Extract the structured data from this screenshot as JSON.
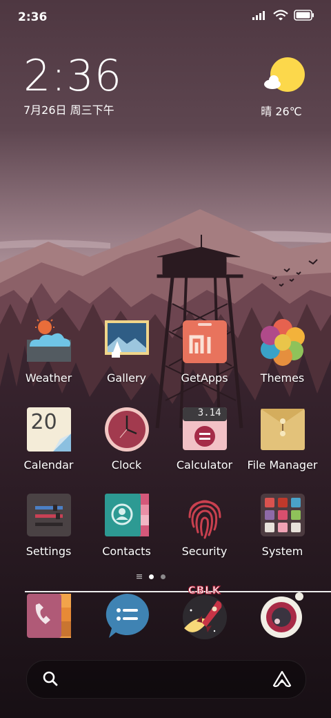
{
  "status_bar": {
    "time": "2:36",
    "icons": [
      "signal-icon",
      "wifi-icon",
      "battery-icon"
    ]
  },
  "clock_widget": {
    "time": "2:36",
    "date": "7月26日 周三下午"
  },
  "weather_widget": {
    "icon": "sunny-cloud-icon",
    "text": "晴 26℃"
  },
  "apps": {
    "row1": [
      {
        "label": "Weather",
        "icon": "weather-icon"
      },
      {
        "label": "Gallery",
        "icon": "gallery-icon"
      },
      {
        "label": "GetApps",
        "icon": "getapps-icon"
      },
      {
        "label": "Themes",
        "icon": "themes-icon"
      }
    ],
    "row2": [
      {
        "label": "Calendar",
        "icon": "calendar-icon",
        "day": "20"
      },
      {
        "label": "Clock",
        "icon": "clock-icon"
      },
      {
        "label": "Calculator",
        "icon": "calculator-icon",
        "display": "3.14"
      },
      {
        "label": "File Manager",
        "icon": "file-manager-icon"
      }
    ],
    "row3": [
      {
        "label": "Settings",
        "icon": "settings-icon"
      },
      {
        "label": "Contacts",
        "icon": "contacts-icon"
      },
      {
        "label": "Security",
        "icon": "fingerprint-icon"
      },
      {
        "label": "System",
        "icon": "system-folder-icon"
      }
    ]
  },
  "page_indicator": {
    "pages": 2,
    "current": 1
  },
  "dock": [
    {
      "icon": "phone-icon"
    },
    {
      "icon": "messages-icon"
    },
    {
      "icon": "rocket-icon",
      "badge_text": "CBLK"
    },
    {
      "icon": "camera-icon"
    }
  ],
  "search_bar": {
    "icon": "search-icon",
    "assistant_icon": "assistant-icon"
  },
  "colors": {
    "sky_top": "#4f3942",
    "sky_mid": "#9c7f88",
    "mountain_light": "#a57d7f",
    "mountain_dark": "#6e4a52",
    "forest": "#3c2730",
    "ground": "#1c1318"
  }
}
